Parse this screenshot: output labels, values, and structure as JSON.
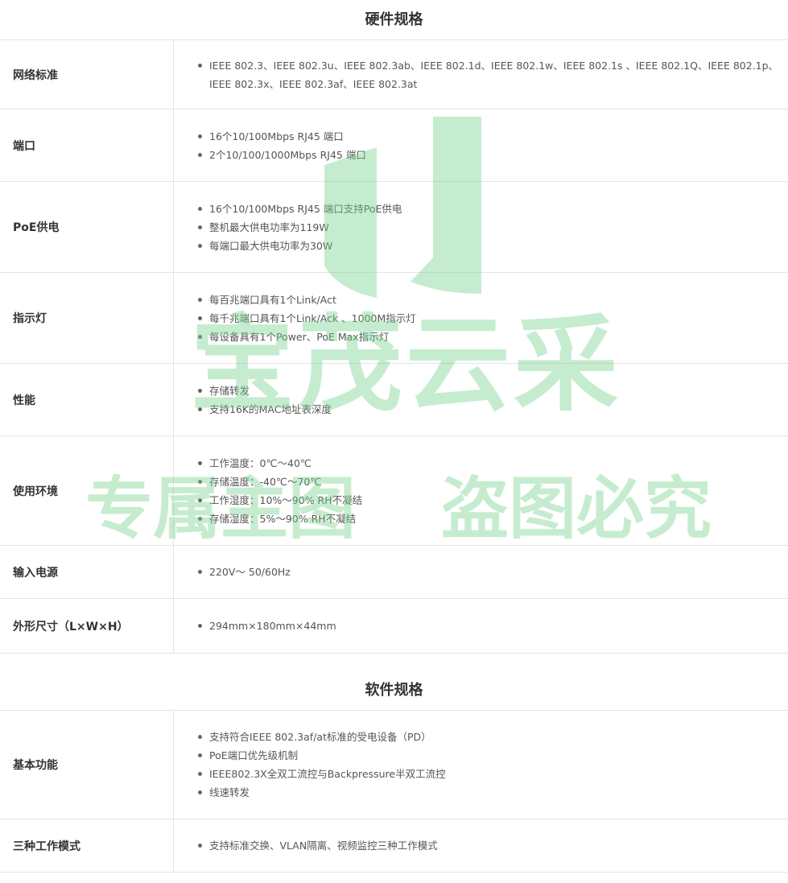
{
  "hardware": {
    "title": "硬件规格",
    "rows": [
      {
        "label": "网络标准",
        "items": [
          "IEEE 802.3、IEEE 802.3u、IEEE 802.3ab、IEEE 802.1d、IEEE 802.1w、IEEE 802.1s 、IEEE 802.1Q、IEEE 802.1p、IEEE 802.3x、IEEE 802.3af、IEEE 802.3at"
        ]
      },
      {
        "label": "端口",
        "items": [
          "16个10/100Mbps RJ45 端口",
          "2个10/100/1000Mbps RJ45 端口"
        ]
      },
      {
        "label": "PoE供电",
        "items": [
          "16个10/100Mbps RJ45 端口支持PoE供电",
          "整机最大供电功率为119W",
          "每端口最大供电功率为30W"
        ]
      },
      {
        "label": "指示灯",
        "items": [
          "每百兆端口具有1个Link/Act",
          "每千兆端口具有1个Link/Ack 、1000M指示灯",
          "每设备具有1个Power、PoE Max指示灯"
        ]
      },
      {
        "label": "性能",
        "items": [
          "存储转发",
          "支持16K的MAC地址表深度"
        ]
      },
      {
        "label": "使用环境",
        "items": [
          "工作温度：0℃～40℃",
          "存储温度：-40℃～70℃",
          "工作湿度：10%～90% RH不凝结",
          "存储湿度：5%～90% RH不凝结"
        ]
      },
      {
        "label": "输入电源",
        "items": [
          "220V～ 50/60Hz"
        ]
      },
      {
        "label": "外形尺寸（L×W×H）",
        "items": [
          "294mm×180mm×44mm"
        ]
      }
    ]
  },
  "software": {
    "title": "软件规格",
    "rows": [
      {
        "label": "基本功能",
        "items": [
          "支持符合IEEE 802.3af/at标准的受电设备（PD）",
          "PoE端口优先级机制",
          "IEEE802.3X全双工流控与Backpressure半双工流控",
          "线速转发"
        ]
      },
      {
        "label": "三种工作模式",
        "items": [
          "支持标准交换、VLAN隔离、视频监控三种工作模式"
        ]
      }
    ]
  },
  "watermark": {
    "brand": "宝茂云采",
    "left_text": "专属主图",
    "right_text": "盗图必究",
    "color": "#78d28c"
  }
}
